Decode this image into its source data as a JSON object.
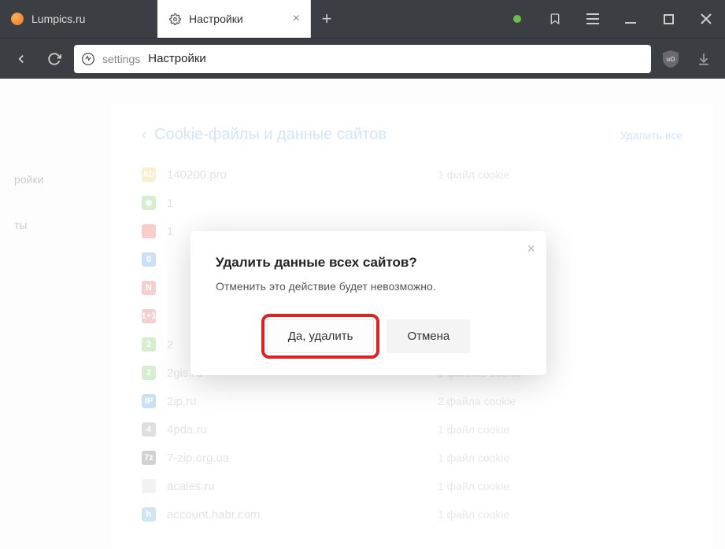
{
  "titlebar": {
    "tabs": [
      {
        "label": "Lumpics.ru",
        "active": false
      },
      {
        "label": "Настройки",
        "active": true
      }
    ]
  },
  "addressbar": {
    "proto": "settings",
    "path": "Настройки"
  },
  "sidebar": {
    "items": [
      {
        "label": "ройки"
      },
      {
        "label": "ты"
      }
    ]
  },
  "breadcrumb": {
    "title": "Cookie-файлы и данные сайтов",
    "delete_all": "Удалить все"
  },
  "sites": [
    {
      "name": "140200.pro",
      "cookies": "1 файл cookie",
      "icon_bg": "#f2c14a",
      "icon_text": "AD"
    },
    {
      "name": "1",
      "cookies": "",
      "icon_bg": "#6bc04b",
      "icon_text": "✱"
    },
    {
      "name": "1",
      "cookies": "",
      "icon_bg": "#e84d3d",
      "icon_text": ""
    },
    {
      "name": "",
      "cookies": "",
      "icon_bg": "#4a90d9",
      "icon_text": "0"
    },
    {
      "name": "",
      "cookies": "",
      "icon_bg": "#d9534f",
      "icon_text": "N"
    },
    {
      "name": "",
      "cookies": "",
      "icon_bg": "#d9534f",
      "icon_text": "1+1"
    },
    {
      "name": "2",
      "cookies": "",
      "icon_bg": "#6bc04b",
      "icon_text": "2"
    },
    {
      "name": "2gis.ru",
      "cookies": "6 файлов cookie",
      "icon_bg": "#6bc04b",
      "icon_text": "2"
    },
    {
      "name": "2ip.ru",
      "cookies": "2 файла cookie",
      "icon_bg": "#4a90d9",
      "icon_text": "IP"
    },
    {
      "name": "4pda.ru",
      "cookies": "1 файл cookie",
      "icon_bg": "#8b8b8b",
      "icon_text": "4"
    },
    {
      "name": "7-zip.org.ua",
      "cookies": "1 файл cookie",
      "icon_bg": "#5a5a5a",
      "icon_text": "7z"
    },
    {
      "name": "acales.ru",
      "cookies": "1 файл cookie",
      "icon_bg": "#d0d0d0",
      "icon_text": ""
    },
    {
      "name": "account.habr.com",
      "cookies": "1 файл cookie",
      "icon_bg": "#5aa0c8",
      "icon_text": "h"
    }
  ],
  "dialog": {
    "title": "Удалить данные всех сайтов?",
    "text": "Отменить это действие будет невозможно.",
    "confirm": "Да, удалить",
    "cancel": "Отмена"
  }
}
